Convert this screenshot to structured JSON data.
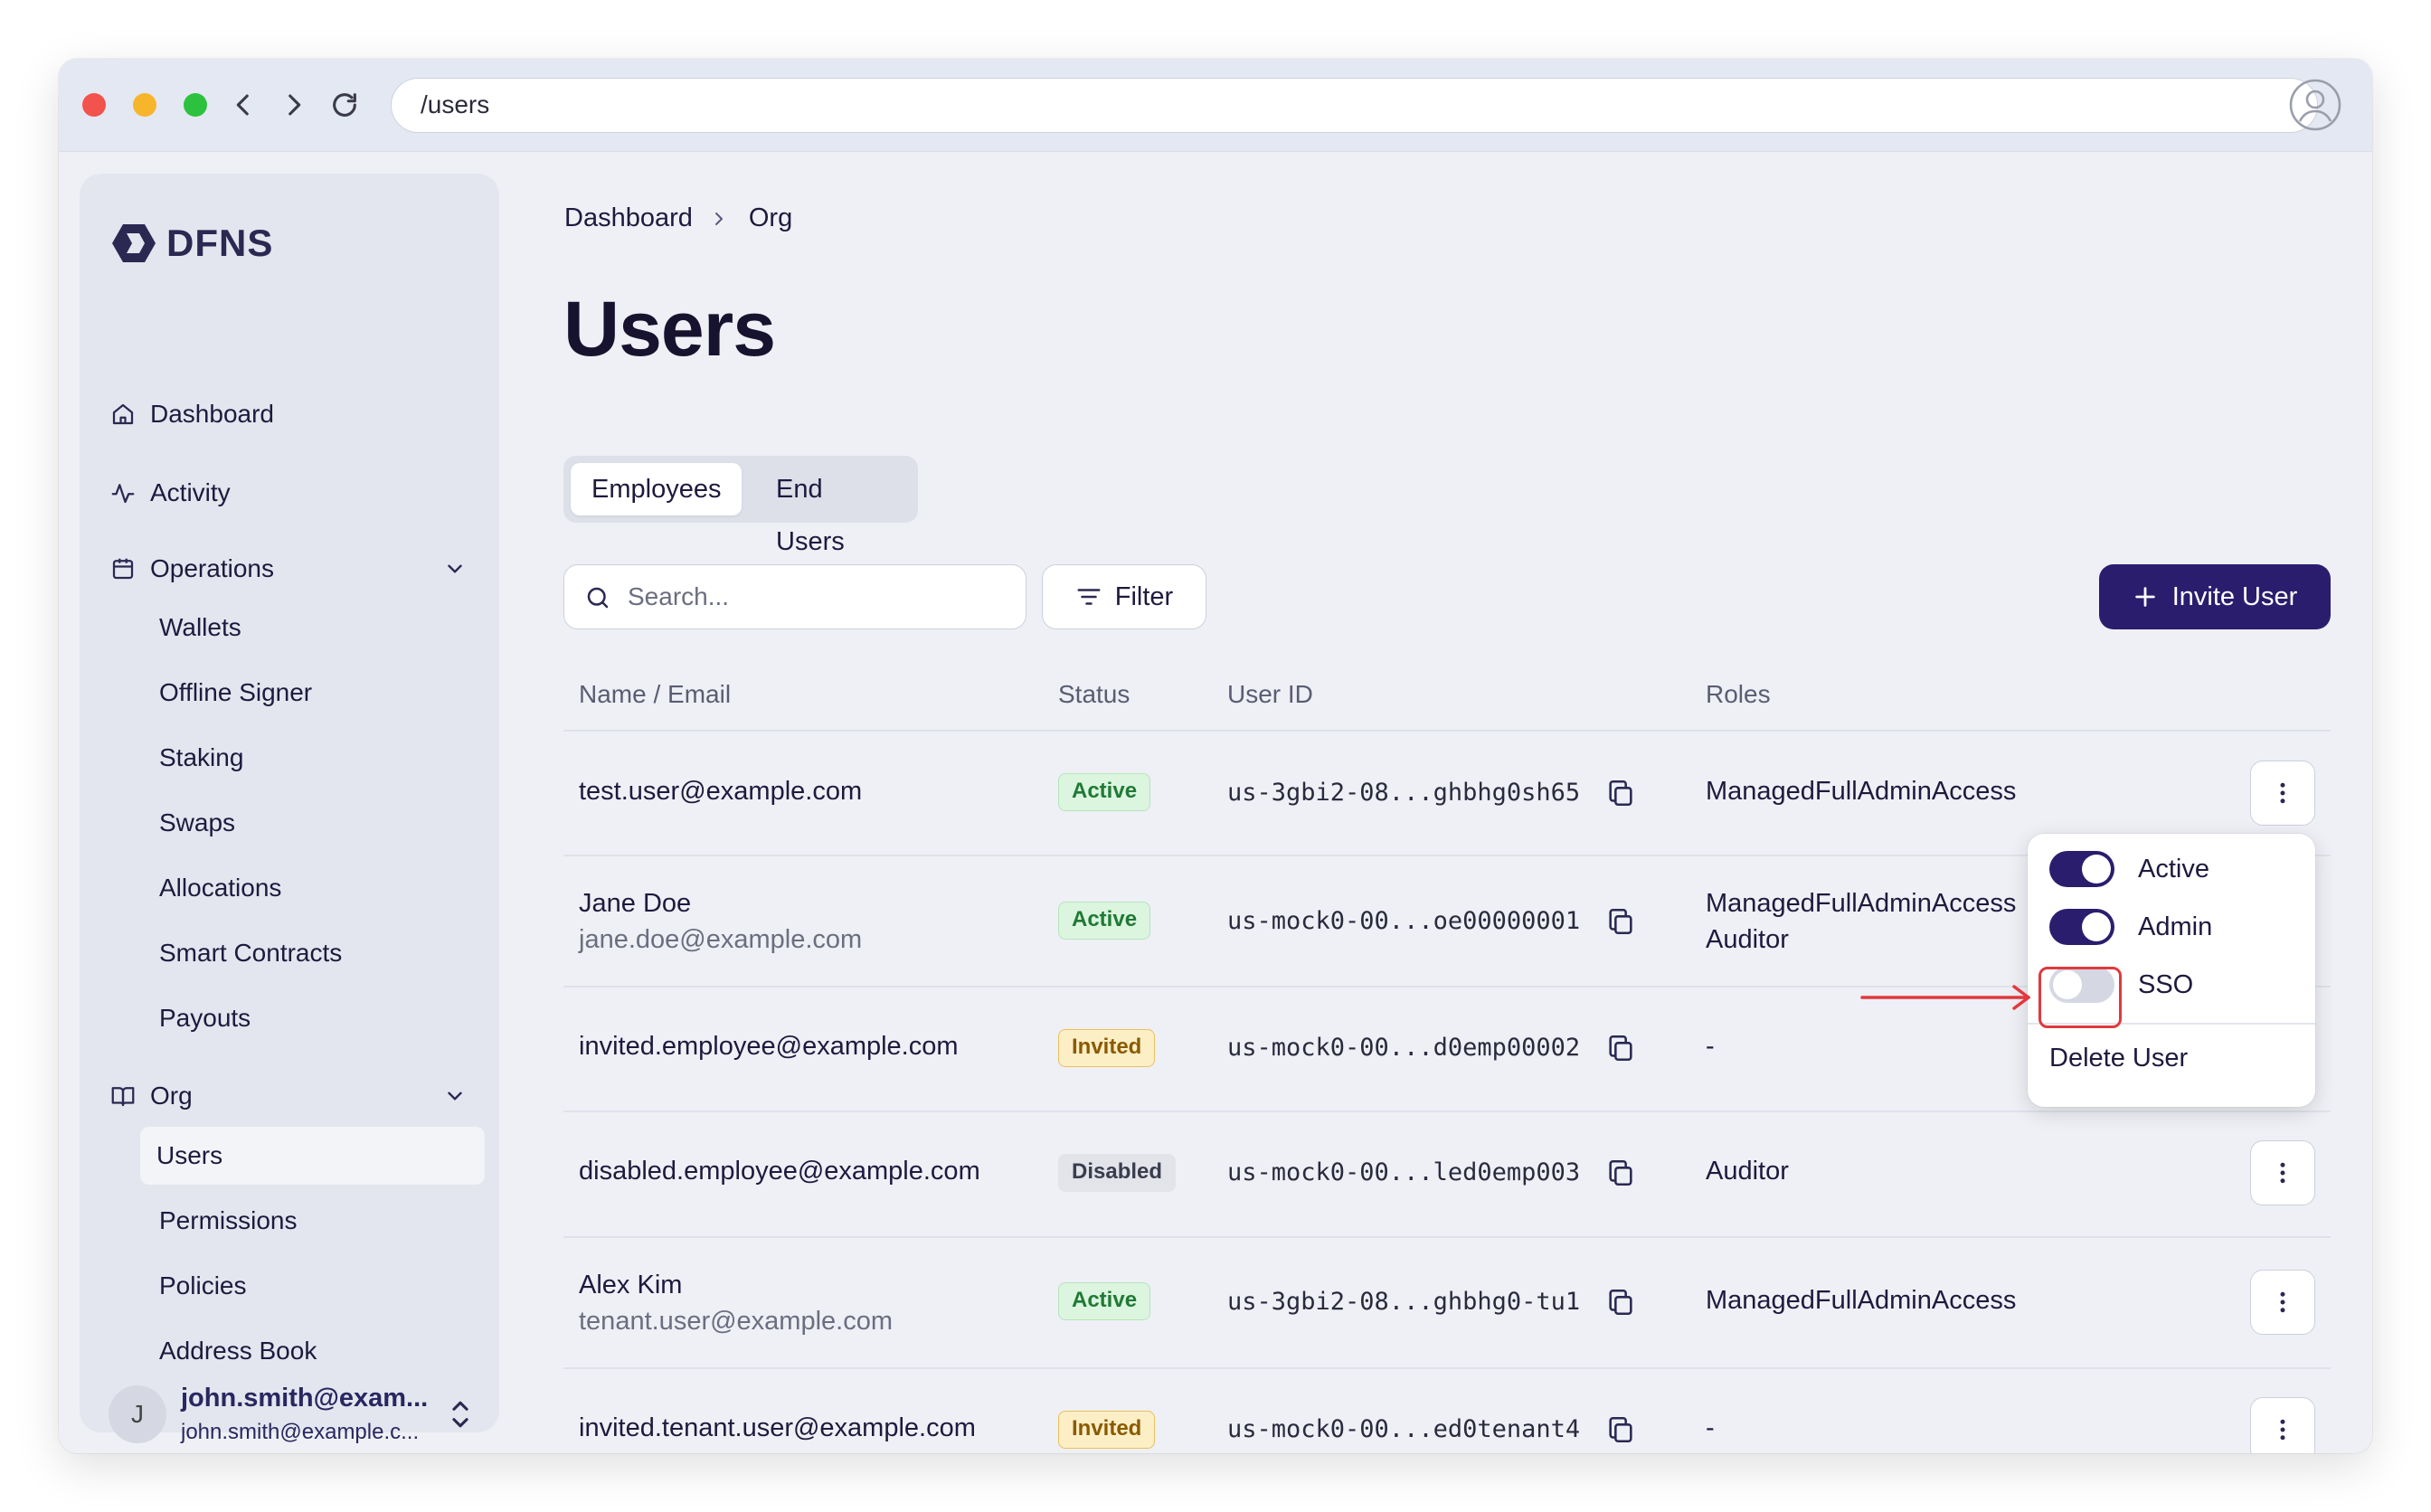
{
  "browser": {
    "url": "/users"
  },
  "brand": {
    "name": "DFNS",
    "color": "#2b2852"
  },
  "sidebar": {
    "nav": [
      {
        "label": "Dashboard",
        "icon": "home-icon"
      },
      {
        "label": "Activity",
        "icon": "activity-icon"
      },
      {
        "label": "Operations",
        "icon": "calendar-icon"
      },
      {
        "label": "Org",
        "icon": "book-icon"
      }
    ],
    "operations_items": [
      "Wallets",
      "Offline Signer",
      "Staking",
      "Swaps",
      "Allocations",
      "Smart Contracts",
      "Payouts"
    ],
    "org_items": [
      "Users",
      "Permissions",
      "Policies",
      "Address Book"
    ],
    "selected_item": "Users",
    "user": {
      "avatar_letter": "J",
      "name": "john.smith@exam...",
      "email": "john.smith@example.c..."
    }
  },
  "breadcrumb": [
    "Dashboard",
    "Org"
  ],
  "page": {
    "title": "Users",
    "tabs": [
      "Employees",
      "End Users"
    ],
    "active_tab": "Employees",
    "search_placeholder": "Search...",
    "filter_label": "Filter",
    "invite_label": "Invite User",
    "accent_color": "#2b1d6e"
  },
  "table": {
    "headers": [
      "Name / Email",
      "Status",
      "User ID",
      "Roles"
    ],
    "rows": [
      {
        "name": "test.user@example.com",
        "email": "",
        "status": "Active",
        "user_id": "us-3gbi2-08...ghbhg0sh65",
        "roles": [
          "ManagedFullAdminAccess"
        ]
      },
      {
        "name": "Jane Doe",
        "email": "jane.doe@example.com",
        "status": "Active",
        "user_id": "us-mock0-00...oe00000001",
        "roles": [
          "ManagedFullAdminAccess",
          "Auditor"
        ]
      },
      {
        "name": "invited.employee@example.com",
        "email": "",
        "status": "Invited",
        "user_id": "us-mock0-00...d0emp00002",
        "roles": [
          "-"
        ]
      },
      {
        "name": "disabled.employee@example.com",
        "email": "",
        "status": "Disabled",
        "user_id": "us-mock0-00...led0emp003",
        "roles": [
          "Auditor"
        ]
      },
      {
        "name": "Alex Kim",
        "email": "tenant.user@example.com",
        "status": "Active",
        "user_id": "us-3gbi2-08...ghbhg0-tu1",
        "roles": [
          "ManagedFullAdminAccess"
        ]
      },
      {
        "name": "invited.tenant.user@example.com",
        "email": "",
        "status": "Invited",
        "user_id": "us-mock0-00...ed0tenant4",
        "roles": [
          "-"
        ]
      }
    ]
  },
  "row_menu": {
    "toggles": [
      {
        "label": "Active",
        "on": true
      },
      {
        "label": "Admin",
        "on": true
      },
      {
        "label": "SSO",
        "on": false
      }
    ],
    "delete_label": "Delete User",
    "highlight_color": "#e0393e"
  }
}
